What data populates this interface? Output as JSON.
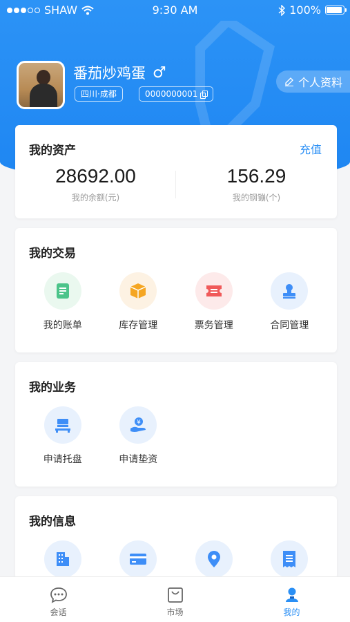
{
  "status_bar": {
    "carrier": "SHAW",
    "time": "9:30 AM",
    "battery": "100%"
  },
  "profile": {
    "name": "番茄炒鸡蛋",
    "gender_symbol": "♂",
    "region": "四川·成都",
    "user_id": "0000000001",
    "edit_button": "个人资料"
  },
  "assets": {
    "title": "我的资产",
    "recharge": "充值",
    "balance_value": "28692.00",
    "balance_label": "我的余额(元)",
    "steel_value": "156.29",
    "steel_label": "我的钢镚(个)"
  },
  "trade": {
    "title": "我的交易",
    "items": [
      {
        "label": "我的账单",
        "icon": "bill-icon"
      },
      {
        "label": "库存管理",
        "icon": "inventory-box-icon"
      },
      {
        "label": "票务管理",
        "icon": "ticket-icon"
      },
      {
        "label": "合同管理",
        "icon": "contract-stamp-icon"
      }
    ]
  },
  "business": {
    "title": "我的业务",
    "items": [
      {
        "label": "申请托盘",
        "icon": "pallet-icon"
      },
      {
        "label": "申请垫资",
        "icon": "yuan-hand-icon"
      }
    ]
  },
  "info": {
    "title": "我的信息",
    "items": [
      {
        "icon": "building-icon"
      },
      {
        "icon": "bank-card-icon"
      },
      {
        "icon": "location-pin-icon"
      },
      {
        "icon": "receipt-icon"
      }
    ]
  },
  "tabs": [
    {
      "label": "会话",
      "icon": "chat-icon",
      "active": false
    },
    {
      "label": "市场",
      "icon": "shopping-bag-icon",
      "active": false
    },
    {
      "label": "我的",
      "icon": "user-icon",
      "active": true
    }
  ],
  "colors": {
    "primary": "#2a8ff5",
    "header": "#1e86f2",
    "bill": "#4cc48a",
    "inventory": "#f5a623",
    "ticket": "#f05a5a",
    "blue_icon": "#3e8ef7"
  }
}
